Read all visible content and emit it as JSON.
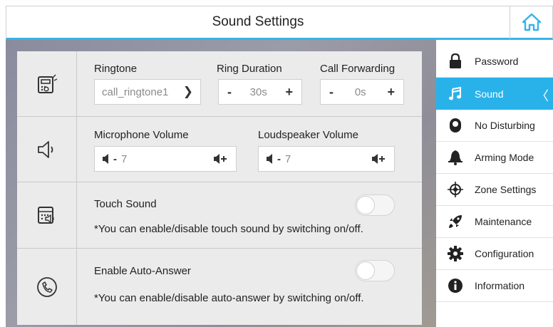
{
  "header": {
    "title": "Sound Settings"
  },
  "ringtone": {
    "label": "Ringtone",
    "value": "call_ringtone1",
    "duration_label": "Ring Duration",
    "duration_value": "30s",
    "forwarding_label": "Call Forwarding",
    "forwarding_value": "0s",
    "minus": "-",
    "plus": "+"
  },
  "volume": {
    "mic_label": "Microphone Volume",
    "mic_value": "7",
    "speaker_label": "Loudspeaker Volume",
    "speaker_value": "7",
    "minus": "-"
  },
  "touch_sound": {
    "label": "Touch Sound",
    "note": "*You can enable/disable touch sound by switching on/off.",
    "enabled": false
  },
  "auto_answer": {
    "label": "Enable Auto-Answer",
    "note": "*You can enable/disable auto-answer by switching on/off.",
    "enabled": false
  },
  "sidebar": {
    "items": [
      {
        "label": "Password",
        "icon": "lock-icon",
        "active": false
      },
      {
        "label": "Sound",
        "icon": "music-note-icon",
        "active": true
      },
      {
        "label": "No Disturbing",
        "icon": "moon-icon",
        "active": false
      },
      {
        "label": "Arming Mode",
        "icon": "bell-icon",
        "active": false
      },
      {
        "label": "Zone Settings",
        "icon": "target-icon",
        "active": false
      },
      {
        "label": "Maintenance",
        "icon": "rocket-icon",
        "active": false
      },
      {
        "label": "Configuration",
        "icon": "gear-icon",
        "active": false
      },
      {
        "label": "Information",
        "icon": "info-icon",
        "active": false
      }
    ]
  },
  "colors": {
    "accent": "#29b2ea",
    "home_icon": "#35b4e6"
  }
}
